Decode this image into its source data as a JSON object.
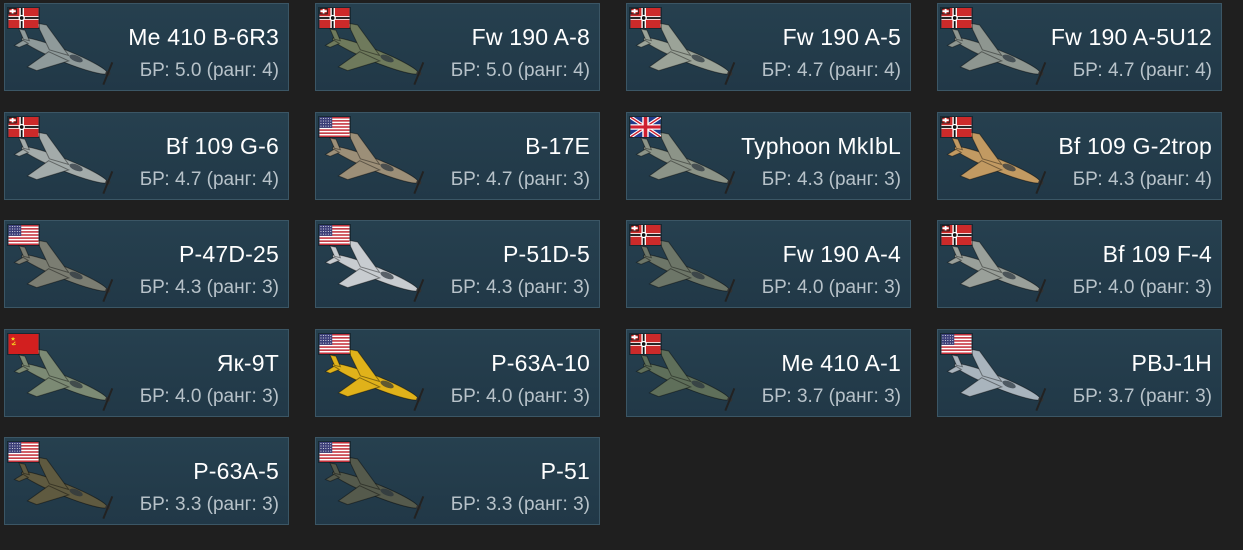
{
  "colors": {
    "background": "#1f1f1f",
    "card": "#25404f",
    "card_border": "#3b5665",
    "name_text": "#ffffff",
    "br_text": "#b7c2c9"
  },
  "vehicles": [
    {
      "name": "Me 410 B-6R3",
      "br": "БР: 5.0 (ранг: 4)",
      "flag": "germany-flag-icon",
      "camo": "#8f9a9a"
    },
    {
      "name": "Fw 190 A-8",
      "br": "БР: 5.0 (ранг: 4)",
      "flag": "germany-flag-icon",
      "camo": "#6f7a5c"
    },
    {
      "name": "Fw 190 A-5",
      "br": "БР: 4.7 (ранг: 4)",
      "flag": "germany-flag-icon",
      "camo": "#9ba398"
    },
    {
      "name": "Fw 190 A-5U12",
      "br": "БР: 4.7 (ранг: 4)",
      "flag": "germany-flag-icon",
      "camo": "#8e9690"
    },
    {
      "name": "Bf 109 G-6",
      "br": "БР: 4.7 (ранг: 4)",
      "flag": "germany-flag-icon",
      "camo": "#a3abaa"
    },
    {
      "name": "B-17E",
      "br": "БР: 4.7 (ранг: 3)",
      "flag": "usa-flag-icon",
      "camo": "#9c8f78"
    },
    {
      "name": "Typhoon MkIbL",
      "br": "БР: 4.3 (ранг: 3)",
      "flag": "uk-flag-icon",
      "camo": "#8c9488"
    },
    {
      "name": "Bf 109 G-2trop",
      "br": "БР: 4.3 (ранг: 4)",
      "flag": "germany-flag-icon",
      "camo": "#c29a62"
    },
    {
      "name": "P-47D-25",
      "br": "БР: 4.3 (ранг: 3)",
      "flag": "usa-flag-icon",
      "camo": "#7b7d72"
    },
    {
      "name": "P-51D-5",
      "br": "БР: 4.3 (ранг: 3)",
      "flag": "usa-flag-icon",
      "camo": "#c8ccd0"
    },
    {
      "name": "Fw 190 A-4",
      "br": "БР: 4.0 (ранг: 3)",
      "flag": "germany-flag-icon",
      "camo": "#6d7668"
    },
    {
      "name": "Bf 109 F-4",
      "br": "БР: 4.0 (ранг: 3)",
      "flag": "germany-flag-icon",
      "camo": "#9aa09a"
    },
    {
      "name": "Як-9Т",
      "br": "БР: 4.0 (ранг: 3)",
      "flag": "ussr-flag-icon",
      "camo": "#7c8a74"
    },
    {
      "name": "P-63A-10",
      "br": "БР: 4.0 (ранг: 3)",
      "flag": "usa-flag-icon",
      "camo": "#e0b21a"
    },
    {
      "name": "Me 410 A-1",
      "br": "БР: 3.7 (ранг: 3)",
      "flag": "germany-flag-icon",
      "camo": "#5f6f5a"
    },
    {
      "name": "PBJ-1H",
      "br": "БР: 3.7 (ранг: 3)",
      "flag": "usa-flag-icon",
      "camo": "#a9b4bd"
    },
    {
      "name": "P-63A-5",
      "br": "БР: 3.3 (ранг: 3)",
      "flag": "usa-flag-icon",
      "camo": "#5f5a40"
    },
    {
      "name": "P-51",
      "br": "БР: 3.3 (ранг: 3)",
      "flag": "usa-flag-icon",
      "camo": "#555a4c"
    }
  ]
}
